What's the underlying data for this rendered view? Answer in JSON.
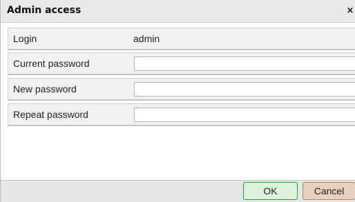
{
  "dialog": {
    "title": "Admin access",
    "close_glyph": "×"
  },
  "fields": [
    {
      "label": "Login",
      "value": "admin"
    },
    {
      "label": "Current password",
      "value": ""
    },
    {
      "label": "New password",
      "value": ""
    },
    {
      "label": "Repeat password",
      "value": ""
    }
  ],
  "buttons": {
    "ok_label": "OK",
    "cancel_label": "Cancel"
  },
  "colors": {
    "ok_border": "#2f9a3f",
    "ok_fill": "#dff0dc",
    "cancel_border": "#a78360",
    "cancel_fill": "#e8d2bd"
  }
}
